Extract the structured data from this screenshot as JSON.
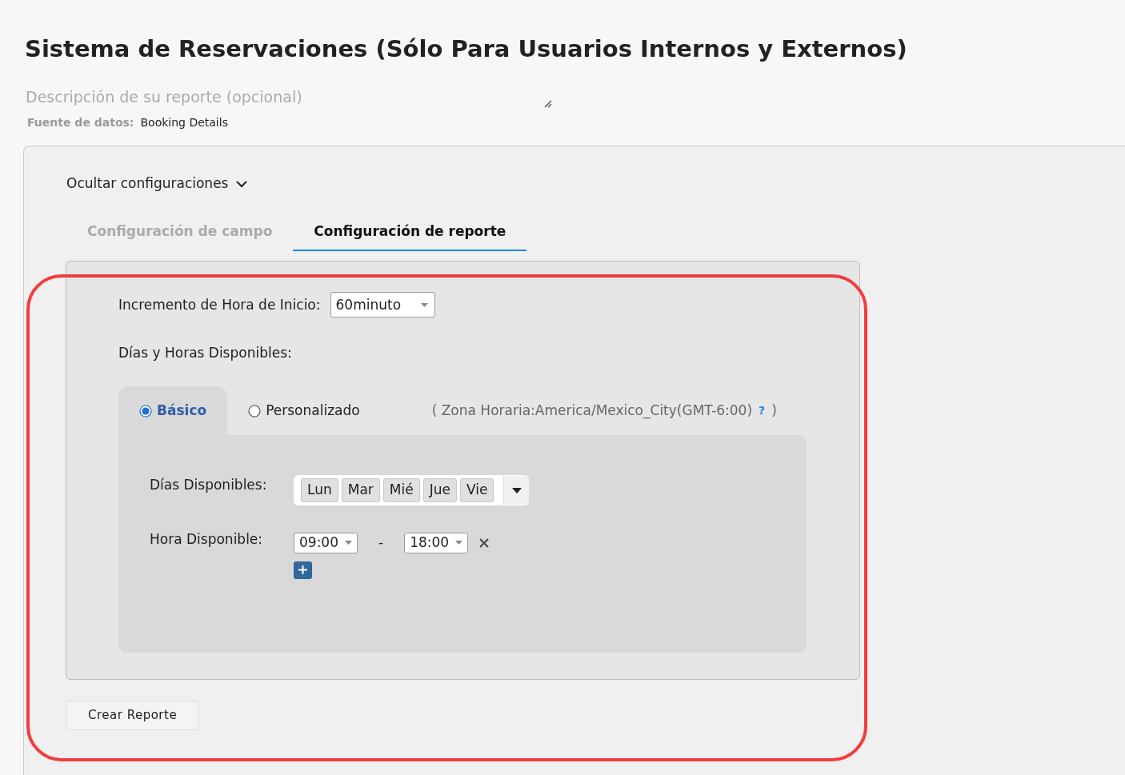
{
  "title": "Sistema de Reservaciones (Sólo Para Usuarios Internos y Externos)",
  "description": {
    "placeholder": "Descripción de su reporte (opcional)"
  },
  "data_source": {
    "label": "Fuente de datos:",
    "value": "Booking Details"
  },
  "settings_toggle": {
    "label": "Ocultar configuraciones",
    "expanded": true
  },
  "tabs": [
    {
      "label": "Configuración de campo",
      "selected": false
    },
    {
      "label": "Configuración de reporte",
      "selected": true
    }
  ],
  "start_increment": {
    "label": "Incremento de Hora de Inicio:",
    "value": "60minuto"
  },
  "availability": {
    "label": "Días y Horas Disponibles:"
  },
  "modes": [
    {
      "label": "Básico",
      "selected": true
    },
    {
      "label": "Personalizado",
      "selected": false
    }
  ],
  "timezone": {
    "open": "( Zona Horaria:America/Mexico_City(GMT-6:00)",
    "help": "?",
    "close": ")"
  },
  "days": {
    "label": "Días Disponibles:",
    "items": [
      "Lun",
      "Mar",
      "Mié",
      "Jue",
      "Vie"
    ]
  },
  "hours": {
    "label": "Hora Disponible:",
    "separator": "-",
    "ranges": [
      {
        "start": "09:00",
        "end": "18:00"
      }
    ]
  },
  "create_button": "Crear Reporte"
}
